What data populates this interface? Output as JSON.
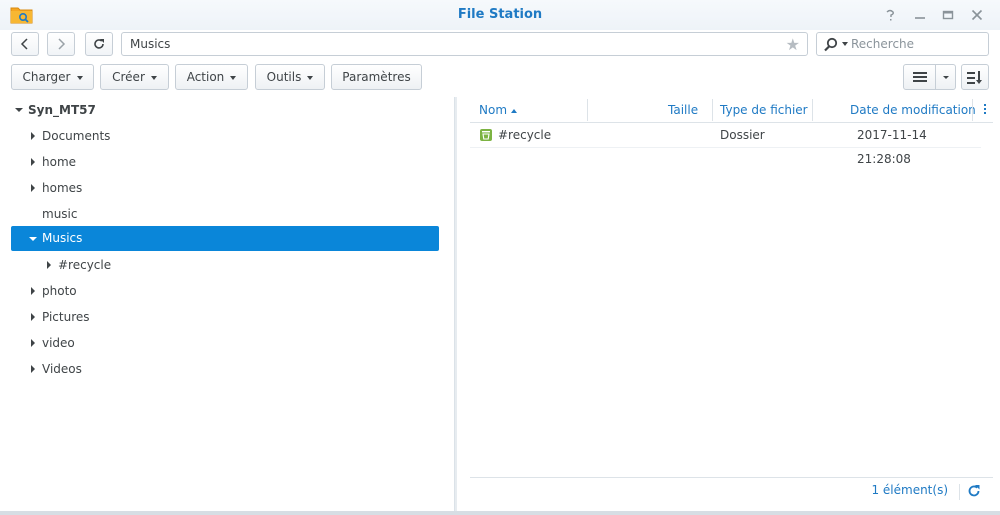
{
  "window": {
    "title": "File Station",
    "help_icon": "help-icon",
    "minimize_icon": "minimize-icon",
    "maximize_icon": "maximize-icon",
    "close_icon": "close-icon"
  },
  "address": {
    "path": "Musics",
    "search_placeholder": "Recherche"
  },
  "toolbar": {
    "upload_label": "Charger",
    "create_label": "Créer",
    "action_label": "Action",
    "tools_label": "Outils",
    "settings_label": "Paramètres"
  },
  "tree": {
    "root": "Syn_MT57",
    "items": [
      {
        "label": "Documents"
      },
      {
        "label": "home"
      },
      {
        "label": "homes"
      },
      {
        "label": "music"
      },
      {
        "label": "Musics"
      },
      {
        "label": "#recycle"
      },
      {
        "label": "photo"
      },
      {
        "label": "Pictures"
      },
      {
        "label": "video"
      },
      {
        "label": "Videos"
      }
    ]
  },
  "grid": {
    "columns": {
      "name": "Nom",
      "size": "Taille",
      "type": "Type de fichier",
      "modified": "Date de modification"
    },
    "rows": [
      {
        "name": "#recycle",
        "size": "",
        "type": "Dossier",
        "modified": "2017-11-14 21:28:08"
      }
    ]
  },
  "status": {
    "count_text": "1 élément(s)"
  },
  "colors": {
    "accent": "#1f7ac4",
    "selection": "#0a86d9",
    "folder_icon": "#7cb342"
  }
}
